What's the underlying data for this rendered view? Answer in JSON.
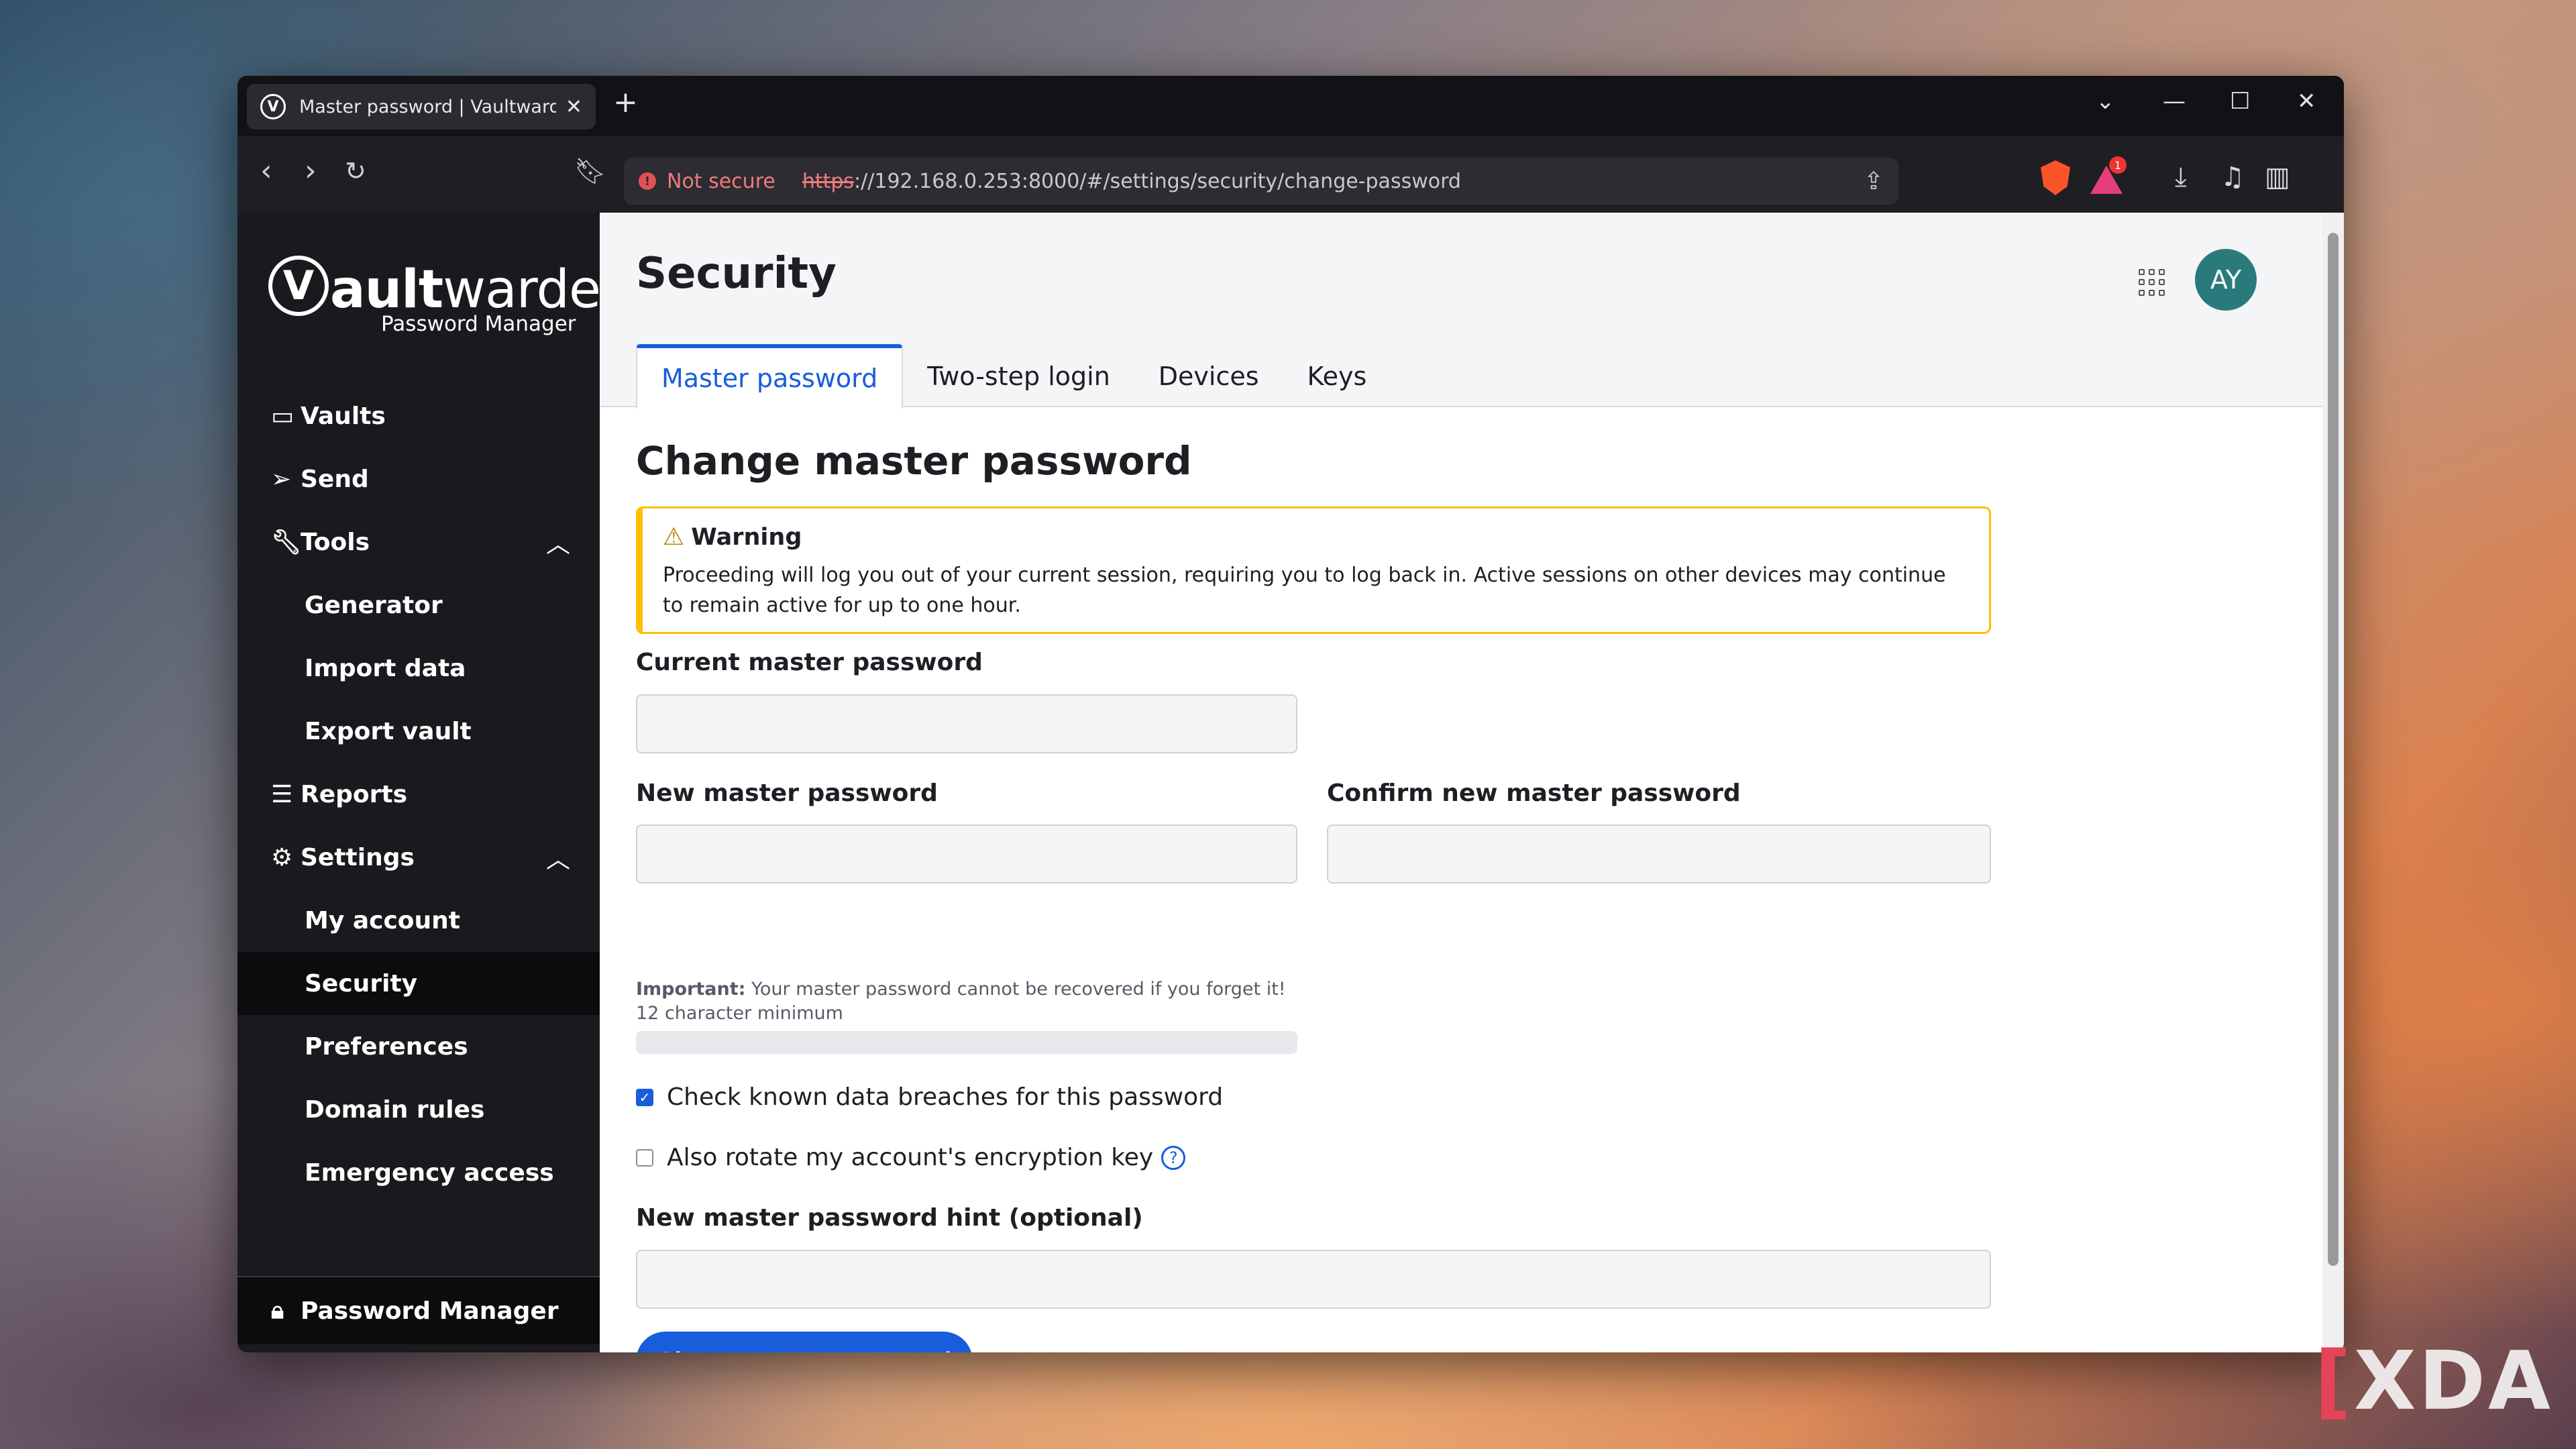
{
  "browser": {
    "tab_title": "Master password | Vaultwarden",
    "tab_favicon": "V",
    "new_tab": "+",
    "url_warning": "Not secure",
    "url_scheme": "https",
    "url_rest": "://192.168.0.253:8000/#/settings/security/change-password",
    "extension_badge": "1"
  },
  "brand": {
    "mark": "V",
    "name_bold": "ault",
    "name_regular": "warden",
    "tagline": "Password Manager"
  },
  "sidebar": {
    "items": [
      {
        "label": "Vaults"
      },
      {
        "label": "Send"
      },
      {
        "label": "Tools"
      },
      {
        "label": "Generator"
      },
      {
        "label": "Import data"
      },
      {
        "label": "Export vault"
      },
      {
        "label": "Reports"
      },
      {
        "label": "Settings"
      },
      {
        "label": "My account"
      },
      {
        "label": "Security"
      },
      {
        "label": "Preferences"
      },
      {
        "label": "Domain rules"
      },
      {
        "label": "Emergency access"
      }
    ],
    "footer_label": "Password Manager"
  },
  "header": {
    "title": "Security",
    "avatar_initials": "AY"
  },
  "tabs": [
    {
      "label": "Master password"
    },
    {
      "label": "Two-step login"
    },
    {
      "label": "Devices"
    },
    {
      "label": "Keys"
    }
  ],
  "form": {
    "section_title": "Change master password",
    "warning_title": "Warning",
    "warning_body": "Proceeding will log you out of your current session, requiring you to log back in. Active sessions on other devices may continue to remain active for up to one hour.",
    "current_label": "Current master password",
    "current_value": "",
    "new_label": "New master password",
    "new_value": "",
    "confirm_label": "Confirm new master password",
    "confirm_value": "",
    "hint_important": "Important:",
    "hint_text": " Your master password cannot be recovered if you forget it! 12 character minimum",
    "strength_fraction": 0,
    "breach_check_label": "Check known data breaches for this password",
    "breach_check_checked": true,
    "rotate_key_label": "Also rotate my account's encryption key",
    "rotate_key_checked": false,
    "hint_label": "New master password hint (optional)",
    "hint_value": "",
    "submit_label": "Change master password"
  },
  "colors": {
    "accent": "#175ddc",
    "warning_border": "#ffbf00",
    "sidebar_bg": "#1a1a1e",
    "avatar_bg": "#2a7a7c"
  },
  "watermark": "XDA"
}
